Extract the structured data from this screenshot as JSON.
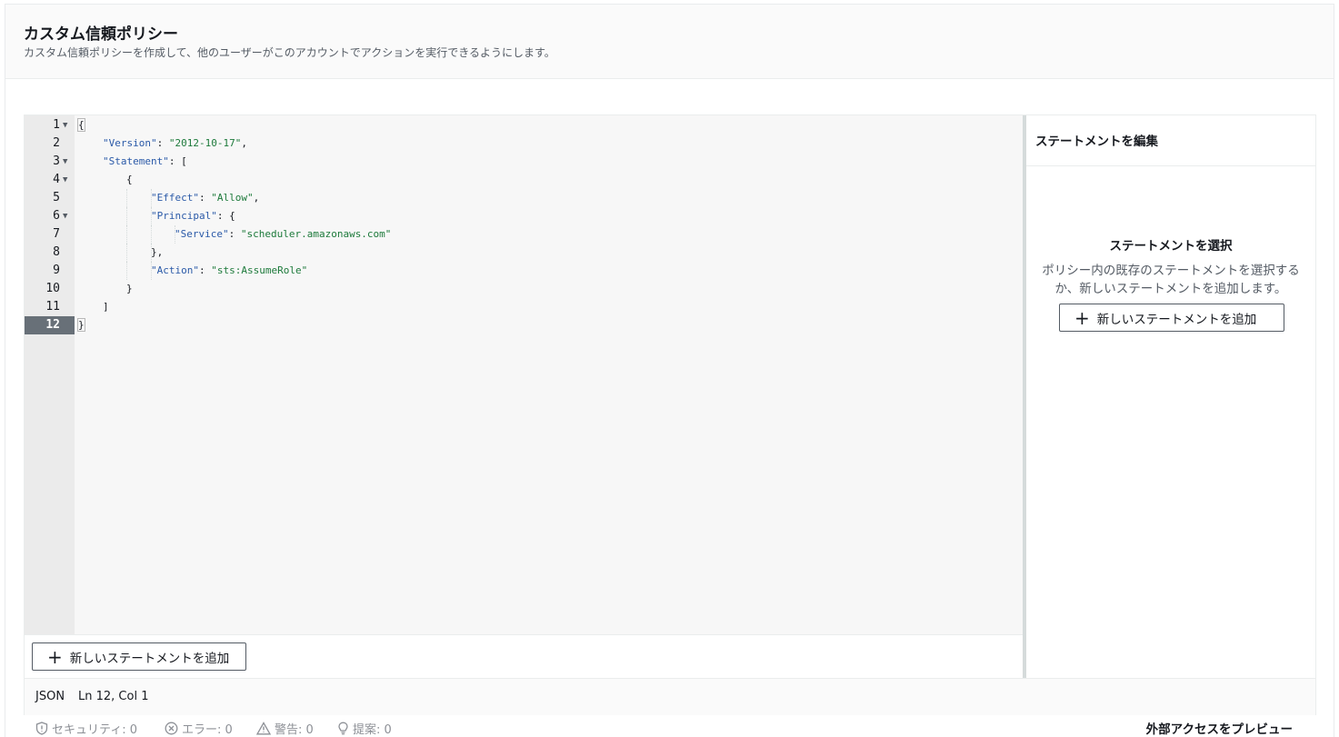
{
  "header": {
    "title": "カスタム信頼ポリシー",
    "description": "カスタム信頼ポリシーを作成して、他のユーザーがこのアカウントでアクションを実行できるようにします。"
  },
  "editor": {
    "line_numbers": [
      "1",
      "2",
      "3",
      "4",
      "5",
      "6",
      "7",
      "8",
      "9",
      "10",
      "11",
      "12"
    ],
    "folded_lines": [
      1,
      3,
      4,
      6
    ],
    "active_line": 12,
    "code": {
      "open_brace": "{",
      "version_key": "\"Version\"",
      "version_value": "\"2012-10-17\"",
      "statement_key": "\"Statement\"",
      "open_bracket": "[",
      "open_obj": "{",
      "effect_key": "\"Effect\"",
      "effect_value": "\"Allow\"",
      "principal_key": "\"Principal\"",
      "principal_open": "{",
      "service_key": "\"Service\"",
      "service_value": "\"scheduler.amazonaws.com\"",
      "principal_close": "},",
      "action_key": "\"Action\"",
      "action_value": "\"sts:AssumeRole\"",
      "close_obj": "}",
      "close_bracket": "]",
      "close_brace": "}"
    },
    "add_statement_label": "新しいステートメントを追加"
  },
  "side_panel": {
    "title": "ステートメントを編集",
    "empty_title": "ステートメントを選択",
    "empty_desc": "ポリシー内の既存のステートメントを選択するか、新しいステートメントを追加します。",
    "add_statement_label": "新しいステートメントを追加"
  },
  "status_bar": {
    "mode": "JSON",
    "position": "Ln 12, Col 1"
  },
  "checks": {
    "security": "セキュリティ: 0",
    "errors": "エラー: 0",
    "warnings": "警告: 0",
    "suggestions": "提案: 0",
    "preview_link": "外部アクセスをプレビュー"
  },
  "icons": [
    "fold-arrow-icon",
    "plus-icon",
    "shield-icon",
    "error-circle-icon",
    "warning-triangle-icon",
    "lightbulb-icon"
  ]
}
